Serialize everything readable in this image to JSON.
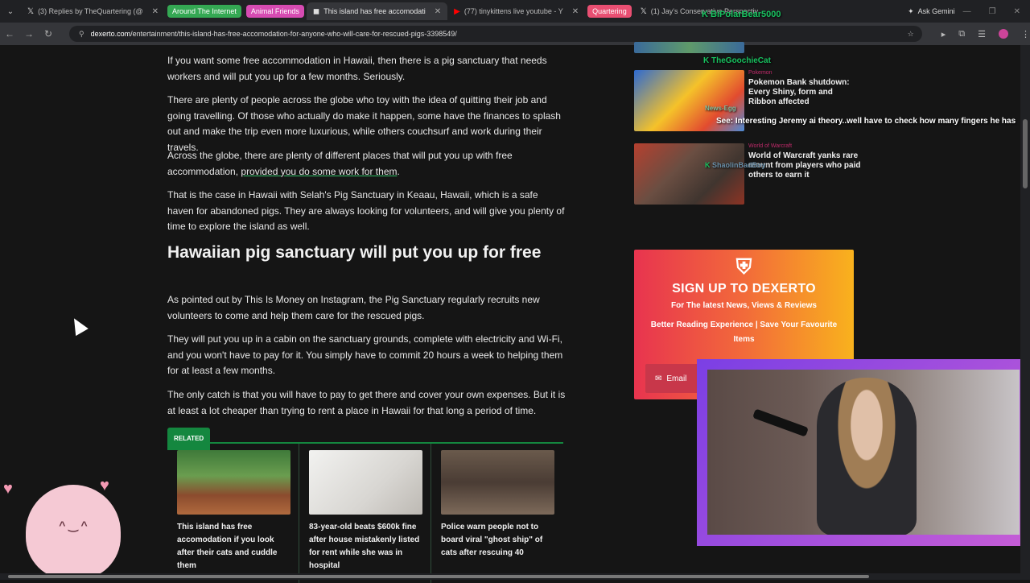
{
  "browser": {
    "tabs": [
      {
        "title": "(3) Replies by TheQuartering (@",
        "icon": "x-logo-icon"
      },
      {
        "group": "Around The Internet",
        "color": "#34a853"
      },
      {
        "group": "Animal Friends",
        "color": "#d64bb2"
      },
      {
        "title": "This island has free accomodati",
        "icon": "dexerto-icon",
        "active": true
      },
      {
        "title": "(77) tinykittens live youtube - Y",
        "icon": "youtube-icon"
      },
      {
        "group": "Quartering",
        "color": "#e94f72"
      },
      {
        "title": "(1) Jay's Conservative Perspectiv",
        "icon": "x-logo-icon"
      }
    ],
    "ask_gemini": "Ask Gemini",
    "url_host": "dexerto.com",
    "url_path": "/entertainment/this-island-has-free-accomodation-for-anyone-who-will-care-for-rescued-pigs-3398549/"
  },
  "article": {
    "p1": "If you want some free accommodation in Hawaii, then there is a pig sanctuary that needs workers and will put you up for a few months. Seriously.",
    "p2": "There are plenty of people across the globe who toy with the idea of quitting their job and going travelling. Of those who actually do make it happen, some have the finances to splash out and make the trip even more luxurious, while others couchsurf and work during their travels.",
    "p3_start": "Across the globe, there are plenty of different places that will put you up with free accommodation, ",
    "p3_link": "provided you do some work for them",
    "p3_end": ".",
    "p4": "That is the case in Hawaii with Selah's Pig Sanctuary in Keaau, Hawaii, which is a safe haven for abandoned pigs. They are always looking for volunteers, and will give you plenty of time to explore the island as well.",
    "heading": "Hawaiian pig sanctuary will put you up for free",
    "p5": "As pointed out by This Is Money on Instagram, the Pig Sanctuary regularly recruits new volunteers to come and help them care for the rescued pigs.",
    "p6": "They will put you up in a cabin on the sanctuary grounds, complete with electricity and Wi-Fi, and you won't have to pay for it. You simply have to commit 20 hours a week to helping them for at least a few months.",
    "p7": "The only catch is that you will have to pay to get there and cover your own expenses. But it is at least a lot cheaper than trying to rent a place in Hawaii for that long a period of time."
  },
  "related": {
    "badge": "RELATED",
    "items": [
      {
        "title": "This island has free accomodation if you look after their cats and cuddle them"
      },
      {
        "title": "83-year-old beats $600k fine after house mistakenly listed for rent while she was in hospital"
      },
      {
        "title": "Police warn people not to board viral \"ghost ship\" of cats after rescuing 40"
      }
    ]
  },
  "sidebar": {
    "cards": [
      {
        "tag": "Pokemon",
        "title": "Pokemon Bank shutdown: Every Shiny, form and Ribbon affected"
      },
      {
        "tag": "World of Warcraft",
        "title": "World of Warcraft yanks rare mount from players who paid others to earn it"
      }
    ]
  },
  "signup": {
    "logo": "⛨",
    "title": "SIGN UP TO DEXERTO",
    "subtitle": "For The latest News, Views & Reviews",
    "benefits": "Better Reading Experience | Save Your Favourite Items",
    "email_placeholder": "Email"
  },
  "stream_overlay": {
    "chat": [
      {
        "user": "BiPolarBear5000",
        "text": ""
      },
      {
        "user": "TheGoochieCat",
        "text": ""
      },
      {
        "user": "News-Egg",
        "text": "See: Interesting Jeremy ai theory..well have to check how many fingers he has"
      },
      {
        "user": "ShaolinBadBoy",
        "text": ""
      }
    ]
  }
}
